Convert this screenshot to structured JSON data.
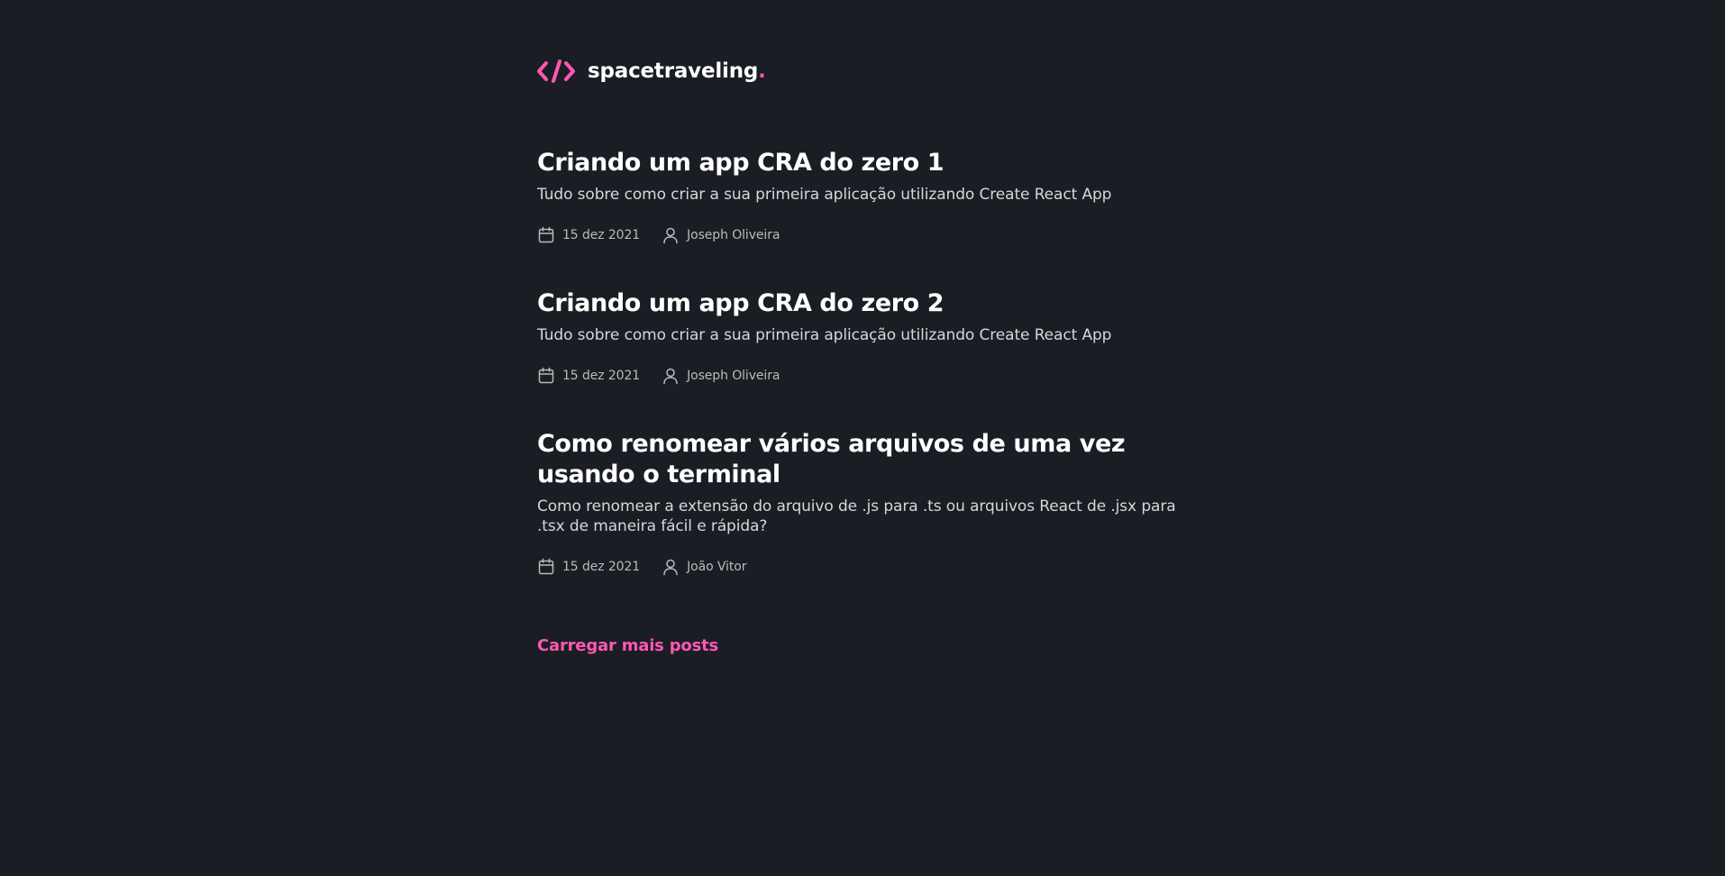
{
  "header": {
    "logo_icon": "code-brackets-icon",
    "logo_text": "spacetraveling",
    "logo_dot": ".",
    "accent_color": "#ff57b2"
  },
  "posts": [
    {
      "title": "Criando um app CRA do zero 1",
      "subtitle": "Tudo sobre como criar a sua primeira aplicação utilizando Create React App",
      "date": "15 dez 2021",
      "author": "Joseph Oliveira"
    },
    {
      "title": "Criando um app CRA do zero 2",
      "subtitle": "Tudo sobre como criar a sua primeira aplicação utilizando Create React App",
      "date": "15 dez 2021",
      "author": "Joseph Oliveira"
    },
    {
      "title": "Como renomear vários arquivos de uma vez usando o terminal",
      "subtitle": "Como renomear a extensão do arquivo de .js para .ts ou arquivos React de .jsx para .tsx de maneira fácil e rápida?",
      "date": "15 dez 2021",
      "author": "João Vitor"
    }
  ],
  "icons": {
    "date": "calendar-icon",
    "author": "user-icon"
  },
  "load_more_label": "Carregar mais posts",
  "colors": {
    "background": "#1a1d23",
    "accent": "#ff57b2",
    "heading": "#ffffff",
    "body_text": "#d7d7d7",
    "info_text": "#bbbbbb"
  }
}
